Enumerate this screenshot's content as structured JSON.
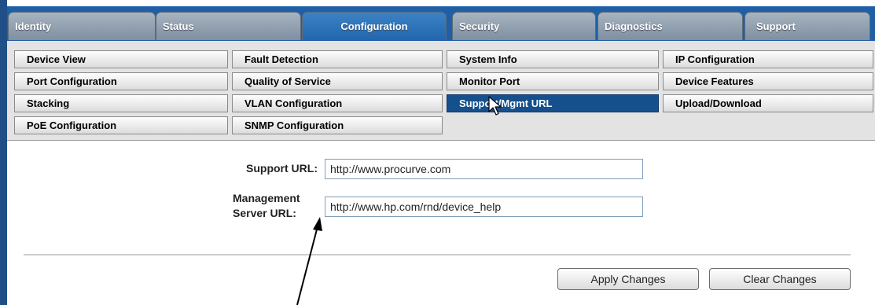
{
  "tabs": [
    {
      "label": "Identity",
      "active": false
    },
    {
      "label": "Status",
      "active": false
    },
    {
      "label": "Configuration",
      "active": true
    },
    {
      "label": "Security",
      "active": false
    },
    {
      "label": "Diagnostics",
      "active": false
    },
    {
      "label": "Support",
      "active": false
    }
  ],
  "subnav": [
    [
      "Device View",
      "Fault Detection",
      "System Info",
      "IP Configuration"
    ],
    [
      "Port Configuration",
      "Quality of Service",
      "Monitor Port",
      "Device Features"
    ],
    [
      "Stacking",
      "VLAN Configuration",
      "Support/Mgmt URL",
      "Upload/Download"
    ],
    [
      "PoE Configuration",
      "SNMP Configuration"
    ]
  ],
  "selected_subnav": "Support/Mgmt URL",
  "form": {
    "support_label": "Support URL:",
    "support_value": "http://www.procurve.com",
    "mgmt_label_line1": "Management",
    "mgmt_label_line2": "Server URL:",
    "mgmt_value": "http://www.hp.com/rnd/device_help"
  },
  "buttons": {
    "apply": "Apply Changes",
    "clear": "Clear Changes"
  },
  "icons": {
    "cursor": "mouse-pointer-icon",
    "annotation": "callout-arrow"
  },
  "colors": {
    "tabbar": "#1f5fa6",
    "active_tab": "#2266ad",
    "selected_nav": "#15508d"
  }
}
